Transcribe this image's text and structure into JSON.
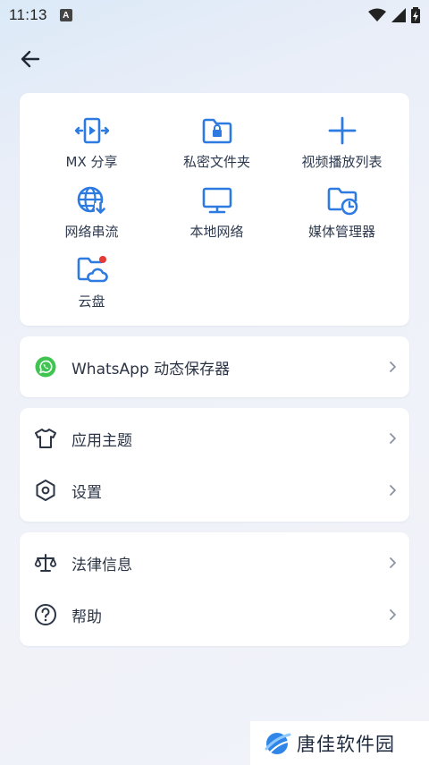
{
  "status_bar": {
    "time": "11:13",
    "indicator": "A"
  },
  "header": {
    "back_icon": "arrow-left-icon"
  },
  "grid": {
    "items": [
      {
        "label": "MX 分享",
        "icon": "mx-share-icon"
      },
      {
        "label": "私密文件夹",
        "icon": "private-folder-icon"
      },
      {
        "label": "视频播放列表",
        "icon": "plus-icon"
      },
      {
        "label": "网络串流",
        "icon": "network-stream-icon"
      },
      {
        "label": "本地网络",
        "icon": "local-network-icon"
      },
      {
        "label": "媒体管理器",
        "icon": "media-manager-icon"
      },
      {
        "label": "云盘",
        "icon": "cloud-drive-icon"
      }
    ]
  },
  "whatsapp": {
    "label": "WhatsApp 动态保存器",
    "icon": "whatsapp-icon"
  },
  "settings_group": {
    "items": [
      {
        "label": "应用主题",
        "icon": "shirt-icon"
      },
      {
        "label": "设置",
        "icon": "settings-hexagon-icon"
      }
    ]
  },
  "info_group": {
    "items": [
      {
        "label": "法律信息",
        "icon": "scales-icon"
      },
      {
        "label": "帮助",
        "icon": "help-icon"
      }
    ]
  },
  "watermark": {
    "text": "唐佳软件园"
  },
  "colors": {
    "accent": "#2d7be0",
    "text": "#2b3445",
    "whatsapp": "#3fc351",
    "badge": "#e53935"
  }
}
